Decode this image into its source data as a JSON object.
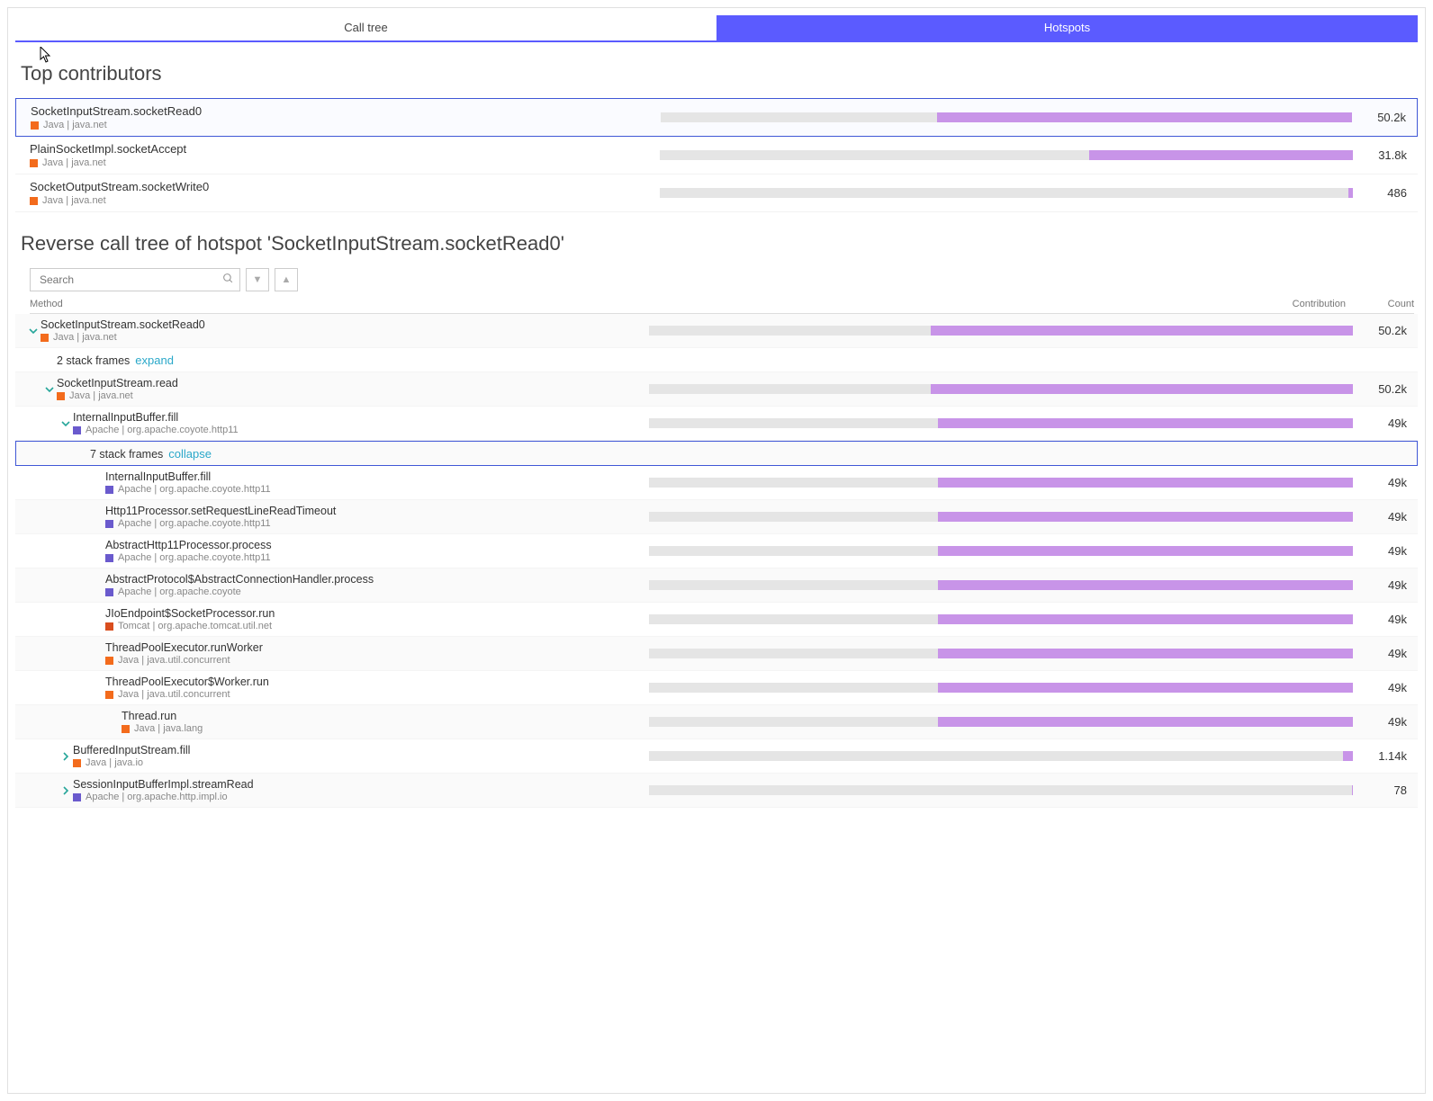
{
  "tabs": {
    "call_tree_label": "Call tree",
    "hotspots_label": "Hotspots"
  },
  "top_contributors_title": "Top contributors",
  "contributors": [
    {
      "method": "SocketInputStream.socketRead0",
      "tech": "Java",
      "pkg": "java.net",
      "swatch": "java",
      "bar_pct": 60,
      "count": "50.2k",
      "selected": true
    },
    {
      "method": "PlainSocketImpl.socketAccept",
      "tech": "Java",
      "pkg": "java.net",
      "swatch": "java",
      "bar_pct": 38,
      "count": "31.8k",
      "selected": false
    },
    {
      "method": "SocketOutputStream.socketWrite0",
      "tech": "Java",
      "pkg": "java.net",
      "swatch": "java",
      "bar_pct": 0.6,
      "count": "486",
      "selected": false
    }
  ],
  "reverse_title": "Reverse call tree of hotspot 'SocketInputStream.socketRead0'",
  "search": {
    "placeholder": "Search"
  },
  "columns": {
    "method": "Method",
    "contribution": "Contribution",
    "count": "Count"
  },
  "tree": [
    {
      "indent": 0,
      "chevron": "down",
      "method": "SocketInputStream.socketRead0",
      "tech": "Java",
      "pkg": "java.net",
      "swatch": "java",
      "bar_pct": 60,
      "count": "50.2k"
    },
    {
      "indent": 1,
      "chevron": "none",
      "stack_text": "2 stack frames",
      "stack_action": "expand"
    },
    {
      "indent": 1,
      "chevron": "down",
      "method": "SocketInputStream.read",
      "tech": "Java",
      "pkg": "java.net",
      "swatch": "java",
      "bar_pct": 60,
      "count": "50.2k"
    },
    {
      "indent": 2,
      "chevron": "down",
      "method": "InternalInputBuffer.fill",
      "tech": "Apache",
      "pkg": "org.apache.coyote.http11",
      "swatch": "apache",
      "bar_pct": 59,
      "count": "49k"
    },
    {
      "indent": 3,
      "chevron": "none",
      "stack_text": "7 stack frames",
      "stack_action": "collapse",
      "highlight": true
    },
    {
      "indent": 4,
      "chevron": "none",
      "method": "InternalInputBuffer.fill",
      "tech": "Apache",
      "pkg": "org.apache.coyote.http11",
      "swatch": "apache",
      "bar_pct": 59,
      "count": "49k"
    },
    {
      "indent": 4,
      "chevron": "none",
      "method": "Http11Processor.setRequestLineReadTimeout",
      "tech": "Apache",
      "pkg": "org.apache.coyote.http11",
      "swatch": "apache",
      "bar_pct": 59,
      "count": "49k"
    },
    {
      "indent": 4,
      "chevron": "none",
      "method": "AbstractHttp11Processor.process",
      "tech": "Apache",
      "pkg": "org.apache.coyote.http11",
      "swatch": "apache",
      "bar_pct": 59,
      "count": "49k"
    },
    {
      "indent": 4,
      "chevron": "none",
      "method": "AbstractProtocol$AbstractConnectionHandler.process",
      "tech": "Apache",
      "pkg": "org.apache.coyote",
      "swatch": "apache",
      "bar_pct": 59,
      "count": "49k"
    },
    {
      "indent": 4,
      "chevron": "none",
      "method": "JIoEndpoint$SocketProcessor.run",
      "tech": "Tomcat",
      "pkg": "org.apache.tomcat.util.net",
      "swatch": "tomcat",
      "bar_pct": 59,
      "count": "49k"
    },
    {
      "indent": 4,
      "chevron": "none",
      "method": "ThreadPoolExecutor.runWorker",
      "tech": "Java",
      "pkg": "java.util.concurrent",
      "swatch": "java",
      "bar_pct": 59,
      "count": "49k"
    },
    {
      "indent": 4,
      "chevron": "none",
      "method": "ThreadPoolExecutor$Worker.run",
      "tech": "Java",
      "pkg": "java.util.concurrent",
      "swatch": "java",
      "bar_pct": 59,
      "count": "49k"
    },
    {
      "indent": 5,
      "chevron": "none",
      "method": "Thread.run",
      "tech": "Java",
      "pkg": "java.lang",
      "swatch": "java",
      "bar_pct": 59,
      "count": "49k"
    },
    {
      "indent": 2,
      "chevron": "right",
      "method": "BufferedInputStream.fill",
      "tech": "Java",
      "pkg": "java.io",
      "swatch": "java",
      "bar_pct": 1.4,
      "count": "1.14k"
    },
    {
      "indent": 2,
      "chevron": "right",
      "method": "SessionInputBufferImpl.streamRead",
      "tech": "Apache",
      "pkg": "org.apache.http.impl.io",
      "swatch": "apache",
      "bar_pct": 0.1,
      "count": "78"
    }
  ]
}
